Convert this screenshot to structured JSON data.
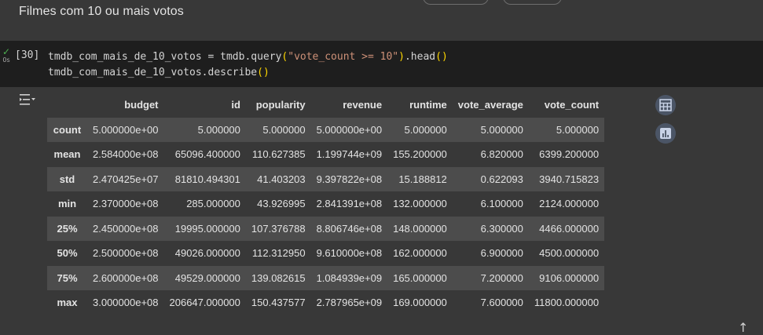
{
  "markdown": {
    "title": "Filmes com 10 ou mais votos"
  },
  "code_cell": {
    "execution_count": "[30]",
    "status_icon": "check-icon",
    "run_time": "0s",
    "lines": [
      "tmdb_com_mais_de_10_votos = tmdb.query(\"vote_count >= 10\").head()",
      "tmdb_com_mais_de_10_votos.describe()"
    ]
  },
  "output": {
    "columns": [
      "budget",
      "id",
      "popularity",
      "revenue",
      "runtime",
      "vote_average",
      "vote_count"
    ],
    "rows": [
      {
        "label": "count",
        "values": [
          "5.000000e+00",
          "5.000000",
          "5.000000",
          "5.000000e+00",
          "5.000000",
          "5.000000",
          "5.000000"
        ]
      },
      {
        "label": "mean",
        "values": [
          "2.584000e+08",
          "65096.400000",
          "110.627385",
          "1.199744e+09",
          "155.200000",
          "6.820000",
          "6399.200000"
        ]
      },
      {
        "label": "std",
        "values": [
          "2.470425e+07",
          "81810.494301",
          "41.403203",
          "9.397822e+08",
          "15.188812",
          "0.622093",
          "3940.715823"
        ]
      },
      {
        "label": "min",
        "values": [
          "2.370000e+08",
          "285.000000",
          "43.926995",
          "2.841391e+08",
          "132.000000",
          "6.100000",
          "2124.000000"
        ]
      },
      {
        "label": "25%",
        "values": [
          "2.450000e+08",
          "19995.000000",
          "107.376788",
          "8.806746e+08",
          "148.000000",
          "6.300000",
          "4466.000000"
        ]
      },
      {
        "label": "50%",
        "values": [
          "2.500000e+08",
          "49026.000000",
          "112.312950",
          "9.610000e+08",
          "162.000000",
          "6.900000",
          "4500.000000"
        ]
      },
      {
        "label": "75%",
        "values": [
          "2.600000e+08",
          "49529.000000",
          "139.082615",
          "1.084939e+09",
          "165.000000",
          "7.200000",
          "9106.000000"
        ]
      },
      {
        "label": "max",
        "values": [
          "3.000000e+08",
          "206647.000000",
          "150.437577",
          "2.787965e+09",
          "169.000000",
          "7.600000",
          "11800.000000"
        ]
      }
    ],
    "side_buttons": [
      "table-icon",
      "chart-icon"
    ],
    "output_icon": "output-toggle-icon"
  },
  "scroll_icon": "arrow-up-icon",
  "colors": {
    "background": "#383838",
    "code_background": "#1e1e1e",
    "stripe": "#4c4c4c",
    "button": "#4b5566",
    "success": "#4caf50",
    "string": "#ce9178",
    "paren": "#ffd700"
  }
}
